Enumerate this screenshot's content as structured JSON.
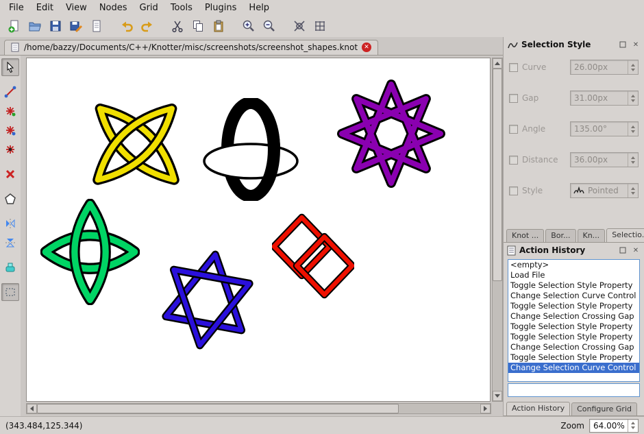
{
  "menu": {
    "items": [
      "File",
      "Edit",
      "View",
      "Nodes",
      "Grid",
      "Tools",
      "Plugins",
      "Help"
    ]
  },
  "toolbar": {
    "buttons": [
      "new-document",
      "open-document",
      "save-document",
      "save-document-as",
      "export-document",
      "undo",
      "redo",
      "cut",
      "copy",
      "paste",
      "zoom-in",
      "zoom-out",
      "knot-display",
      "grid-toggle"
    ]
  },
  "document_tab": {
    "path": "/home/bazzy/Documents/C++/Knotter/misc/screenshots/screenshot_shapes.knot"
  },
  "tools_palette": [
    "select",
    "edit-graph",
    "add-node",
    "connect-nodes",
    "move-nodes",
    "delete-node",
    "polygon",
    "mirror-horizontal",
    "mirror-vertical",
    "fill-style",
    "rectangle-select"
  ],
  "selection_style": {
    "title": "Selection Style",
    "rows": [
      {
        "label": "Curve",
        "value": "26.00px",
        "enabled": false
      },
      {
        "label": "Gap",
        "value": "31.00px",
        "enabled": false
      },
      {
        "label": "Angle",
        "value": "135.00°",
        "enabled": false
      },
      {
        "label": "Distance",
        "value": "36.00px",
        "enabled": false
      },
      {
        "label": "Style",
        "value": "Pointed",
        "enabled": false
      }
    ]
  },
  "dock_tabs": {
    "items": [
      "Knot ...",
      "Bor...",
      "Kn...",
      "Selectio..."
    ],
    "active_index": 3
  },
  "action_history": {
    "title": "Action History",
    "items": [
      "<empty>",
      "Load File",
      "Toggle Selection Style Property",
      "Change Selection Curve Control",
      "Toggle Selection Style Property",
      "Change Selection Crossing Gap",
      "Toggle Selection Style Property",
      "Toggle Selection Style Property",
      "Change Selection Crossing Gap",
      "Toggle Selection Style Property",
      "Change Selection Curve Control"
    ],
    "selected_index": 10
  },
  "bottom_dock_tabs": {
    "items": [
      "Action History",
      "Configure Grid"
    ],
    "active_index": 0
  },
  "status_bar": {
    "coordinates": "(343.484,125.344)",
    "zoom_label": "Zoom",
    "zoom_value": "64.00%"
  },
  "canvas": {
    "knots": [
      {
        "name": "yellow-knot",
        "color": "#f0df00"
      },
      {
        "name": "black-oval-knot",
        "color": "#000000"
      },
      {
        "name": "purple-star-knot",
        "color": "#8a00b0"
      },
      {
        "name": "green-quatrefoil-knot",
        "color": "#00d464"
      },
      {
        "name": "blue-hexagram-knot",
        "color": "#2a10dc"
      },
      {
        "name": "red-square-knot",
        "color": "#ee1000"
      }
    ]
  },
  "colors": {
    "selection_highlight": "#3a6ecd",
    "window_background": "#d7d3d0"
  }
}
